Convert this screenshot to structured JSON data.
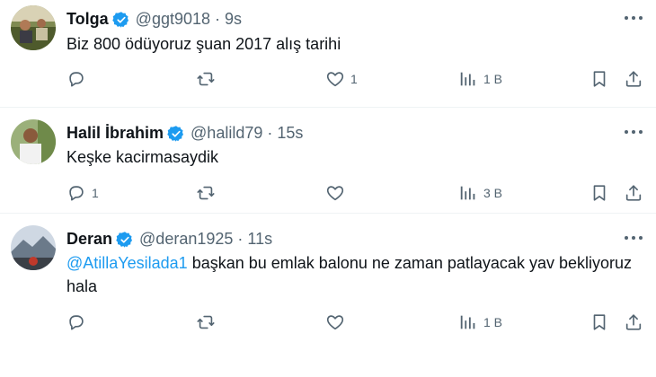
{
  "tweets": [
    {
      "name": "Tolga",
      "handle": "@ggt9018",
      "separator": "·",
      "time": "9s",
      "text": "Biz 800 ödüyoruz şuan 2017 alış tarihi",
      "replies": "",
      "retweets": "",
      "likes": "1",
      "views": "1 B"
    },
    {
      "name": "Halil İbrahim",
      "handle": "@halild79",
      "separator": "·",
      "time": "15s",
      "text": "Keşke kacirmasaydik",
      "replies": "1",
      "retweets": "",
      "likes": "",
      "views": "3 B"
    },
    {
      "name": "Deran",
      "handle": "@deran1925",
      "separator": "·",
      "time": "11s",
      "mention": "@AtillaYesilada1",
      "text": " başkan bu emlak balonu ne zaman patlayacak yav bekliyoruz hala",
      "replies": "",
      "retweets": "",
      "likes": "",
      "views": "1 B"
    }
  ],
  "colors": {
    "verified": "#1d9bf0",
    "mention": "#1d9bf0",
    "muted": "#536471",
    "text": "#0f1419"
  },
  "icons": [
    "reply-icon",
    "retweet-icon",
    "like-icon",
    "views-icon",
    "bookmark-icon",
    "share-icon",
    "more-icon",
    "verified-badge-icon"
  ]
}
